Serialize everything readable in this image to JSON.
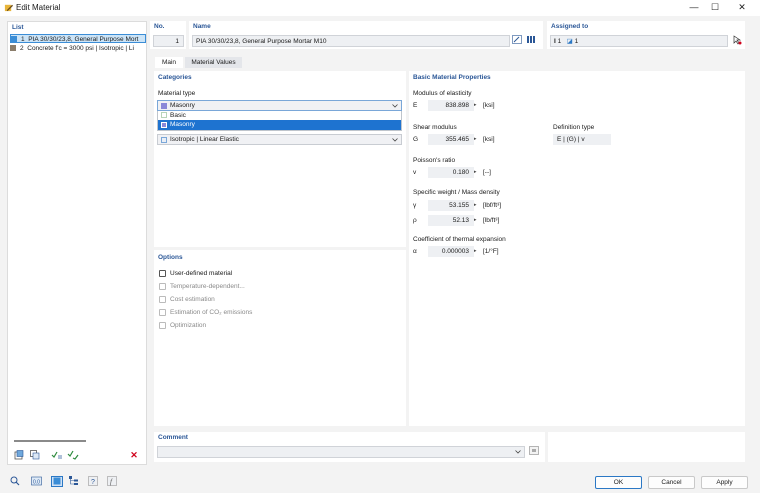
{
  "window": {
    "title": "Edit Material",
    "minimize": "—",
    "maximize": "☐",
    "close": "✕"
  },
  "list": {
    "header": "List",
    "items": [
      {
        "num": "1",
        "label": "PIA 30/30/23,8, General Purpose Mort",
        "color": "#3b8dd6"
      },
      {
        "num": "2",
        "label": "Concrete f'c = 3000 psi | Isotropic | Li",
        "color": "#8b7d6b"
      }
    ]
  },
  "header": {
    "no_label": "No.",
    "no_value": "1",
    "name_label": "Name",
    "name_value": "PIA 30/30/23,8, General Purpose Mortar M10",
    "assigned_label": "Assigned to",
    "assigned_value": "1",
    "assigned_value2": "1"
  },
  "tabs": [
    {
      "label": "Main"
    },
    {
      "label": "Material Values"
    }
  ],
  "categories": {
    "header": "Categories",
    "material_type_label": "Material type",
    "selected": "Masonry",
    "options": [
      "Basic",
      "Masonry"
    ],
    "model": "Isotropic | Linear Elastic",
    "swatch_color": "#8a88d8"
  },
  "options": {
    "header": "Options",
    "items": [
      {
        "label": "User-defined material",
        "enabled": true
      },
      {
        "label": "Temperature-dependent...",
        "enabled": false
      },
      {
        "label": "Cost estimation",
        "enabled": false
      },
      {
        "label": "Estimation of CO₂ emissions",
        "enabled": false
      },
      {
        "label": "Optimization",
        "enabled": false
      }
    ]
  },
  "basic": {
    "header": "Basic Material Properties",
    "modulus_label": "Modulus of elasticity",
    "e_sym": "E",
    "e_val": "838.898",
    "e_unit": "[ksi]",
    "shear_label": "Shear modulus",
    "g_sym": "G",
    "g_val": "355.465",
    "g_unit": "[ksi]",
    "deftype_label": "Definition type",
    "deftype_val": "E | (G) | v",
    "poisson_label": "Poisson's ratio",
    "v_sym": "v",
    "v_val": "0.180",
    "v_unit": "[--]",
    "weight_label": "Specific weight / Mass density",
    "y_sym": "γ",
    "y_val": "53.155",
    "y_unit": "[lbf/ft³]",
    "rho_sym": "ρ",
    "rho_val": "52.13",
    "rho_unit": "[lb/ft³]",
    "thermal_label": "Coefficient of thermal expansion",
    "a_sym": "α",
    "a_val": "0.000003",
    "a_unit": "[1/°F]"
  },
  "comment": {
    "label": "Comment"
  },
  "buttons": {
    "ok": "OK",
    "cancel": "Cancel",
    "apply": "Apply"
  },
  "colors": {
    "accent": "#2b5797",
    "selection": "#1e73d0"
  }
}
